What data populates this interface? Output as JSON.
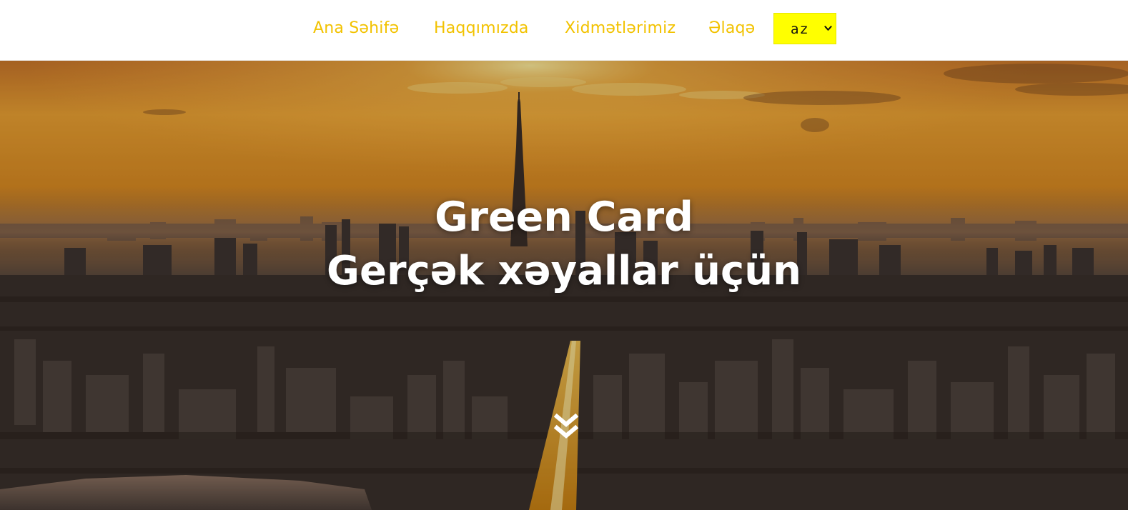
{
  "nav": {
    "items": [
      {
        "label": "Ana Səhifə"
      },
      {
        "label": "Haqqımızda"
      },
      {
        "label": "Xidmətlərimiz"
      },
      {
        "label": "Əlaqə"
      }
    ],
    "language": {
      "selected": "az"
    }
  },
  "hero": {
    "title_line1": "Green Card",
    "title_line2": "Gerçək xəyallar üçün",
    "scroll_icon": "double-chevron-down-icon"
  },
  "colors": {
    "nav_link": "#f2c200",
    "lang_bg": "#ffff00",
    "hero_text": "#ffffff",
    "sky_top": "#e89a2a",
    "city_dark": "#2e2620"
  }
}
